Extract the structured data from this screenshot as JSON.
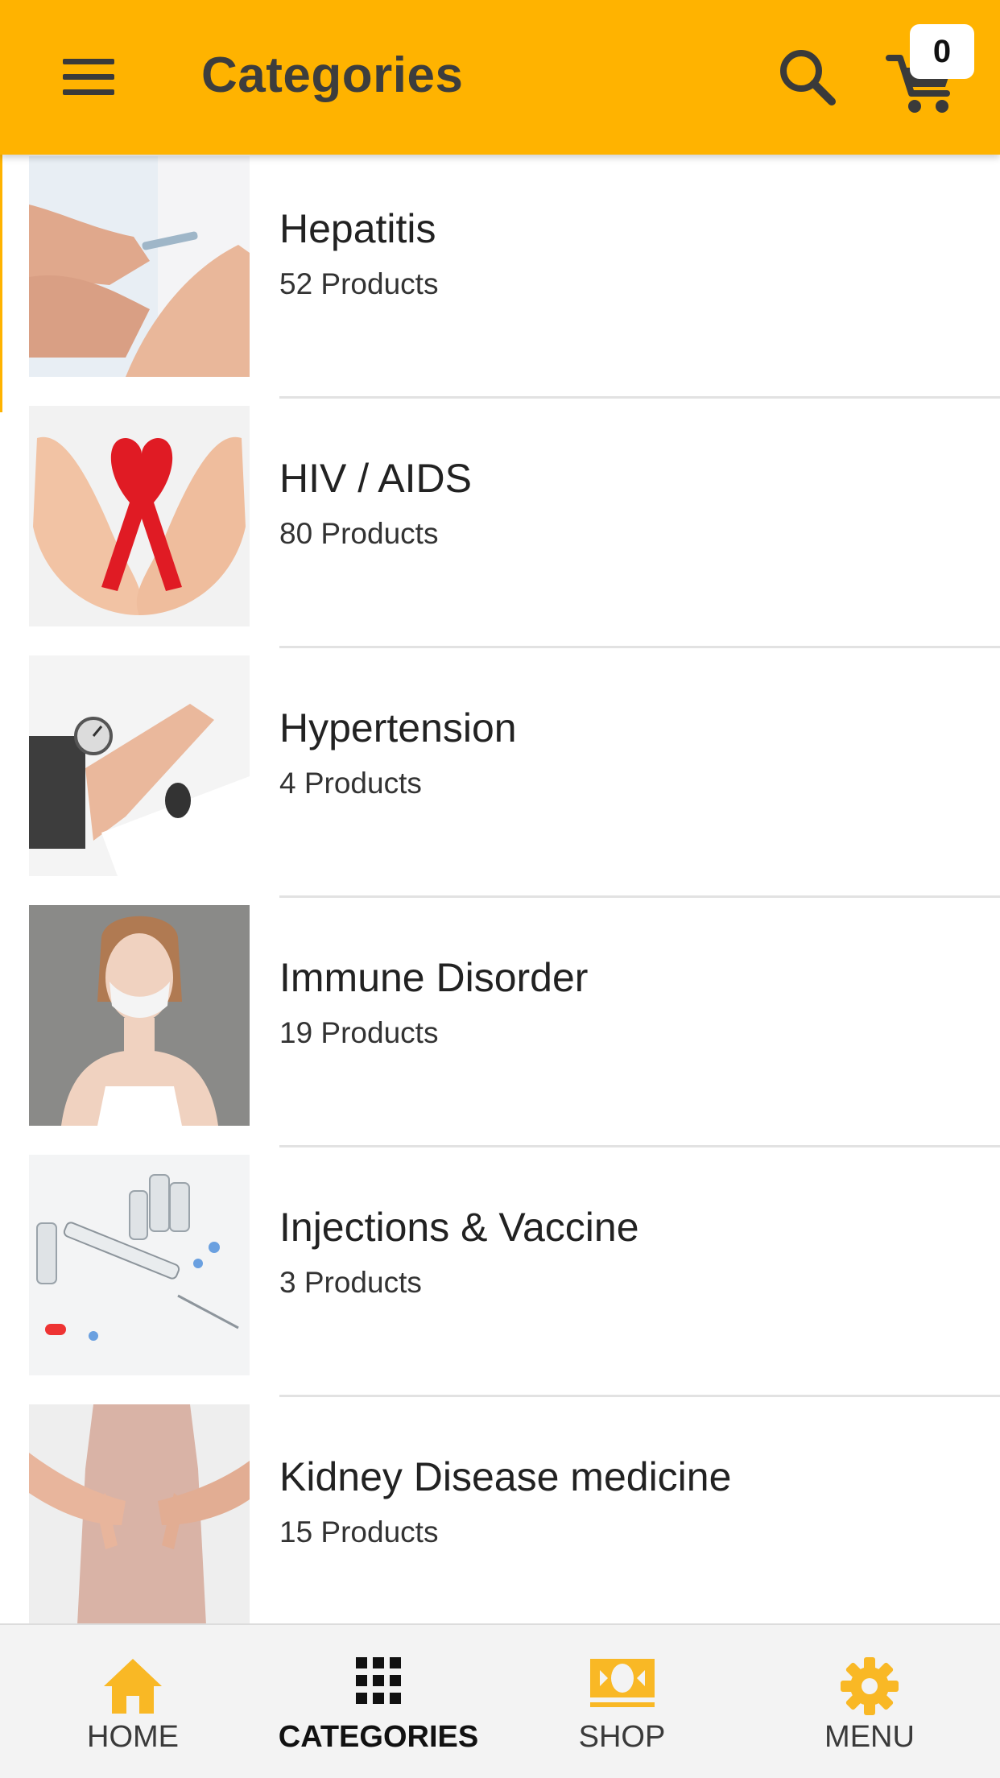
{
  "header": {
    "title": "Categories",
    "cart_count": "0"
  },
  "categories": [
    {
      "name": "Hepatitis",
      "count": "52 Products"
    },
    {
      "name": "HIV / AIDS",
      "count": "80 Products"
    },
    {
      "name": "Hypertension",
      "count": "4 Products"
    },
    {
      "name": "Immune Disorder",
      "count": "19 Products"
    },
    {
      "name": "Injections & Vaccine",
      "count": "3 Products"
    },
    {
      "name": "Kidney Disease medicine",
      "count": "15 Products"
    }
  ],
  "bottom_nav": {
    "items": [
      {
        "label": "HOME",
        "icon": "home-icon"
      },
      {
        "label": "CATEGORIES",
        "icon": "grid-icon"
      },
      {
        "label": "SHOP",
        "icon": "banknote-icon"
      },
      {
        "label": "MENU",
        "icon": "gear-icon"
      }
    ],
    "active": "CATEGORIES"
  },
  "colors": {
    "accent": "#FFB300",
    "icon_active": "#111111",
    "icon_inactive": "#F9B825"
  }
}
